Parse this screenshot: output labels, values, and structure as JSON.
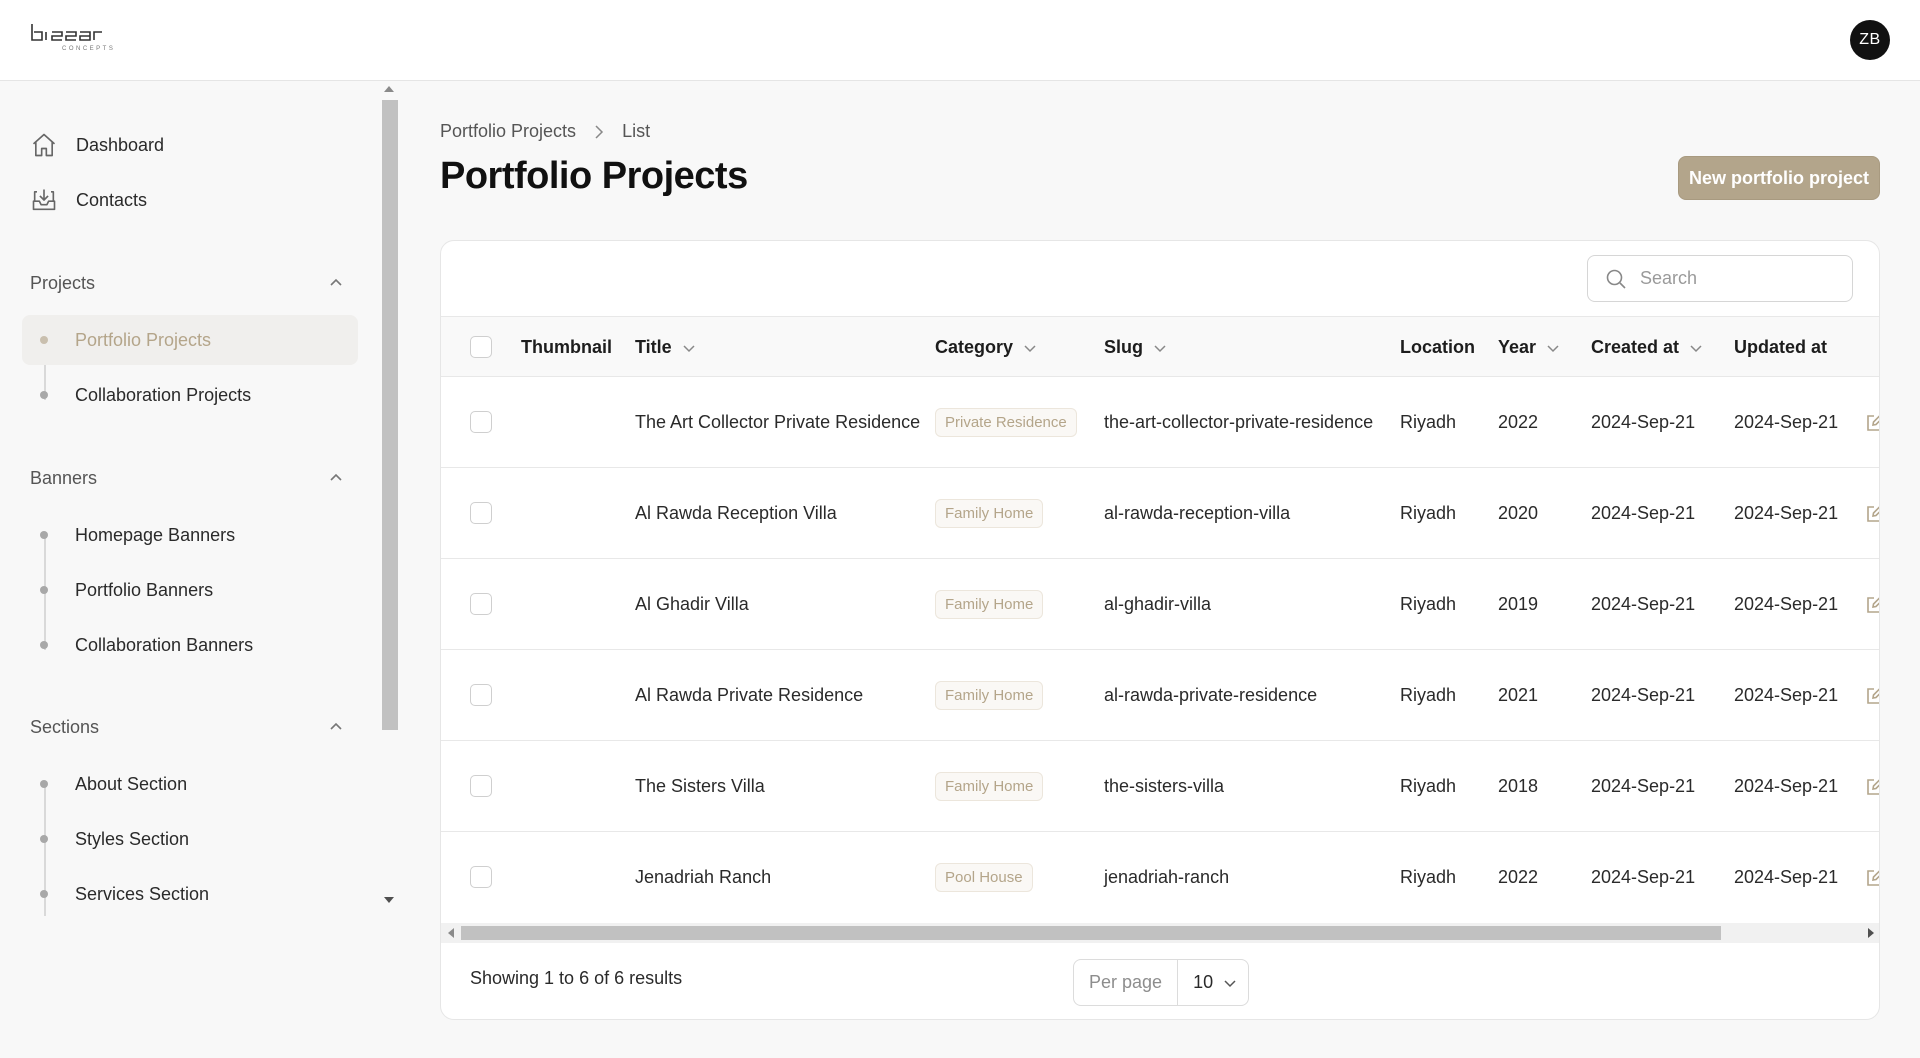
{
  "brand": {
    "logo_text": "bissar",
    "logo_subtext": "CONCEPTS",
    "accent_color": "#b3a58b"
  },
  "user": {
    "initials": "ZB"
  },
  "sidebar": {
    "top_items": [
      {
        "label": "Dashboard",
        "icon": "home-icon"
      },
      {
        "label": "Contacts",
        "icon": "inbox-icon"
      }
    ],
    "groups": [
      {
        "label": "Projects",
        "items": [
          "Portfolio Projects",
          "Collaboration Projects"
        ],
        "active": "Portfolio Projects"
      },
      {
        "label": "Banners",
        "items": [
          "Homepage Banners",
          "Portfolio Banners",
          "Collaboration Banners"
        ]
      },
      {
        "label": "Sections",
        "items": [
          "About Section",
          "Styles Section",
          "Services Section"
        ]
      }
    ]
  },
  "breadcrumb": {
    "parent": "Portfolio Projects",
    "current": "List"
  },
  "page_title": "Portfolio Projects",
  "new_button_label": "New portfolio project",
  "search": {
    "placeholder": "Search"
  },
  "table": {
    "columns": [
      "Thumbnail",
      "Title",
      "Category",
      "Slug",
      "Location",
      "Year",
      "Created at",
      "Updated at"
    ],
    "rows": [
      {
        "title": "The Art Collector Private Residence",
        "category": "Private Residence",
        "slug": "the-art-collector-private-residence",
        "location": "Riyadh",
        "year": "2022",
        "created": "2024-Sep-21",
        "updated": "2024-Sep-21"
      },
      {
        "title": "Al Rawda Reception Villa",
        "category": "Family Home",
        "slug": "al-rawda-reception-villa",
        "location": "Riyadh",
        "year": "2020",
        "created": "2024-Sep-21",
        "updated": "2024-Sep-21"
      },
      {
        "title": "Al Ghadir Villa",
        "category": "Family Home",
        "slug": "al-ghadir-villa",
        "location": "Riyadh",
        "year": "2019",
        "created": "2024-Sep-21",
        "updated": "2024-Sep-21"
      },
      {
        "title": "Al Rawda Private Residence",
        "category": "Family Home",
        "slug": "al-rawda-private-residence",
        "location": "Riyadh",
        "year": "2021",
        "created": "2024-Sep-21",
        "updated": "2024-Sep-21"
      },
      {
        "title": "The Sisters Villa",
        "category": "Family Home",
        "slug": "the-sisters-villa",
        "location": "Riyadh",
        "year": "2018",
        "created": "2024-Sep-21",
        "updated": "2024-Sep-21"
      },
      {
        "title": "Jenadriah Ranch",
        "category": "Pool House",
        "slug": "jenadriah-ranch",
        "location": "Riyadh",
        "year": "2022",
        "created": "2024-Sep-21",
        "updated": "2024-Sep-21"
      }
    ]
  },
  "footer": {
    "summary": "Showing 1 to 6 of 6 results",
    "per_page_label": "Per page",
    "per_page_value": "10"
  }
}
